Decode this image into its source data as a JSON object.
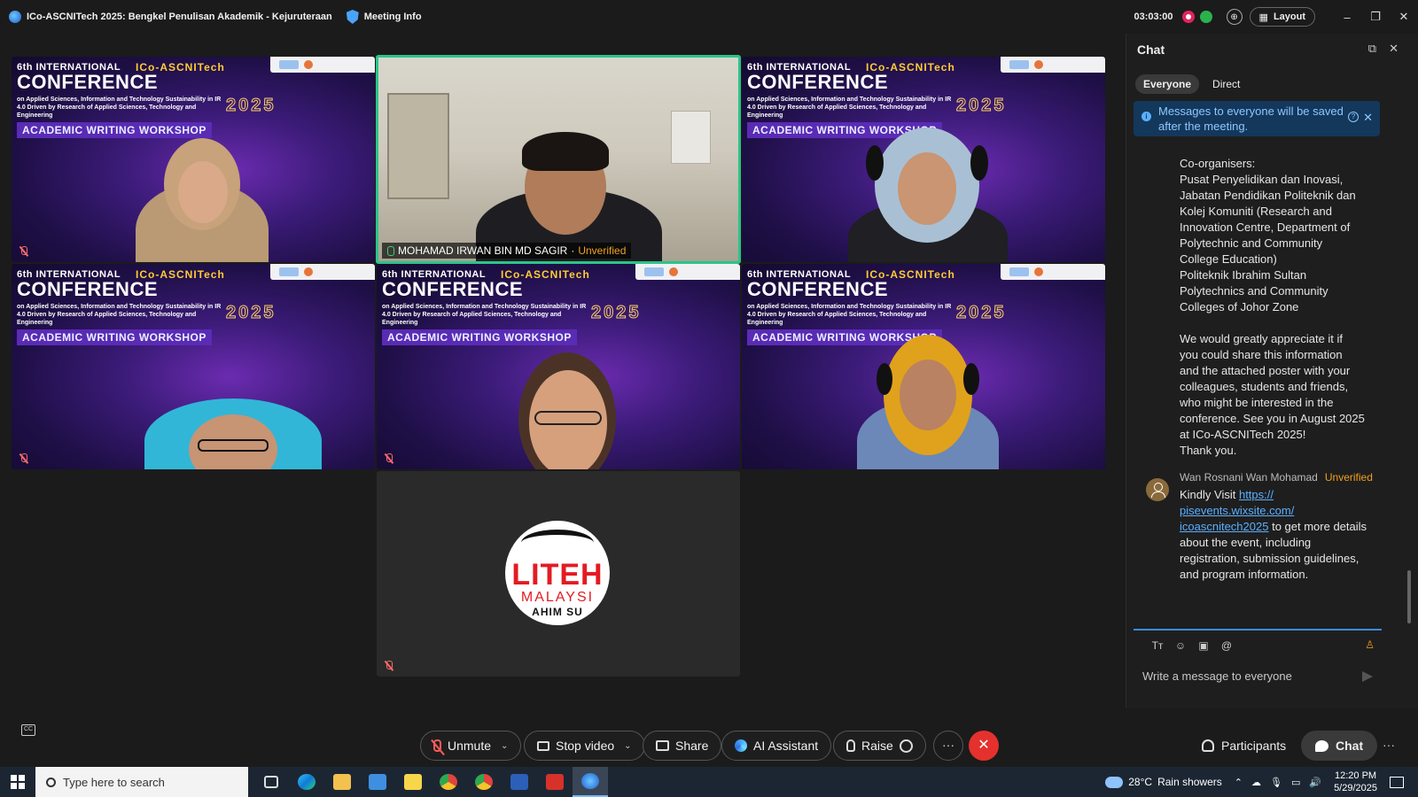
{
  "window": {
    "title": "ICo-ASCNITech 2025: Bengkel Penulisan Akademik - Kejuruteraan",
    "meeting_info": "Meeting Info",
    "timer": "03:03:00",
    "layout_label": "Layout",
    "minimize": "–",
    "restore": "❐",
    "close": "✕"
  },
  "slide": {
    "top": "6th INTERNATIONAL",
    "brand": "ICo-ASCNITech",
    "title": "CONFERENCE",
    "subtitle": "on Applied Sciences, Information and Technology Sustainability in IR 4.0 Driven by Research of Applied Sciences, Technology and Engineering",
    "year": "2025",
    "workshop": "ACADEMIC WRITING WORKSHOP"
  },
  "participants_grid": {
    "active_speaker_name": "MOHAMAD IRWAN BIN MD SAGIR",
    "active_speaker_status": "Unverified",
    "logo_line1": "LITEH",
    "logo_line2": "MALAYSI",
    "logo_line3": "AHIM SU"
  },
  "chat": {
    "title": "Chat",
    "tabs": [
      "Everyone",
      "Direct"
    ],
    "notice": "Messages to everyone will be saved after the meeting.",
    "message1_lines": [
      "Co-organisers:",
      "Pusat Penyelidikan dan Inovasi,",
      "Jabatan Pendidikan Politeknik dan",
      "Kolej Komuniti (Research and",
      "Innovation Centre, Department of",
      "Polytechnic and Community",
      "College Education)",
      "Politeknik Ibrahim Sultan",
      "Polytechnics and Community",
      "Colleges of Johor Zone",
      "",
      "We would greatly appreciate it if",
      "you could share this information",
      "and the attached poster with your",
      "colleagues, students and friends,",
      "who might be interested in the",
      "conference. See you in August 2025",
      "at ICo-ASCNITech 2025!",
      "Thank you."
    ],
    "message2": {
      "author": "Wan Rosnani Wan Mohamad",
      "status": "Unverified",
      "prefix": "Kindly Visit ",
      "link": "https://pisevents.wixsite.com/icoascnitech2025",
      "link_lines": [
        "https://",
        "pisevents.wixsite.com/",
        "icoascnitech2025"
      ],
      "suffix": " to get more details about the event, including registration, submission guidelines, and program information."
    },
    "compose_placeholder": "Write a message to everyone"
  },
  "toolbar": {
    "unmute": "Unmute",
    "stop_video": "Stop video",
    "share": "Share",
    "ai_assistant": "AI Assistant",
    "raise": "Raise",
    "more": "···",
    "end": "✕",
    "participants": "Participants",
    "chat": "Chat",
    "more_right": "···"
  },
  "taskbar": {
    "search_placeholder": "Type here to search",
    "weather_temp": "28°C",
    "weather_desc": "Rain showers",
    "time": "12:20 PM",
    "date": "5/29/2025"
  },
  "colors": {
    "accent": "#2bc48a",
    "end_call": "#e5312d",
    "link": "#5ab0ff",
    "unverified": "#f0a020"
  }
}
